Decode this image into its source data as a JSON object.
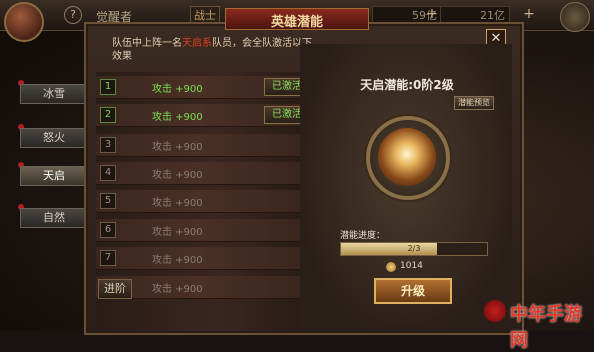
{
  "topbar": {
    "help": "?",
    "title": "觉醒者",
    "badge": "战士",
    "resource1": "59亿",
    "resource2": "21亿"
  },
  "sidebar": {
    "tabs": [
      {
        "label": "冰雪"
      },
      {
        "label": "怒火"
      },
      {
        "label": "天启"
      },
      {
        "label": "自然"
      }
    ]
  },
  "dialog": {
    "title": "英雄潜能",
    "close": "✕",
    "description_prefix": "队伍中上阵一名",
    "description_highlight": "天启系",
    "description_suffix": "队员，会全队激活以下效果"
  },
  "potential_list": {
    "rows": [
      {
        "num": "1",
        "bonus": "攻击 +900",
        "status": "已激活"
      },
      {
        "num": "2",
        "bonus": "攻击 +900",
        "status": "已激活"
      },
      {
        "num": "3",
        "bonus": "攻击 +900",
        "status": ""
      },
      {
        "num": "4",
        "bonus": "攻击 +900",
        "status": ""
      },
      {
        "num": "5",
        "bonus": "攻击 +900",
        "status": ""
      },
      {
        "num": "6",
        "bonus": "攻击 +900",
        "status": ""
      },
      {
        "num": "7",
        "bonus": "攻击 +900",
        "status": ""
      }
    ],
    "advanced_label": "进阶",
    "advanced_bonus": "攻击 +900"
  },
  "potential_detail": {
    "title": "天启潜能:0阶2级",
    "preview_label": "潜能预览",
    "progress_label": "潜能进度：",
    "progress_text": "2/3",
    "progress_fraction": 0.66,
    "cost": "1014",
    "upgrade_label": "升级"
  },
  "watermark": {
    "text": "中年手游网"
  },
  "colors": {
    "active_green": "#7ae050",
    "highlight_red": "#e04020",
    "gold": "#e0b060"
  }
}
